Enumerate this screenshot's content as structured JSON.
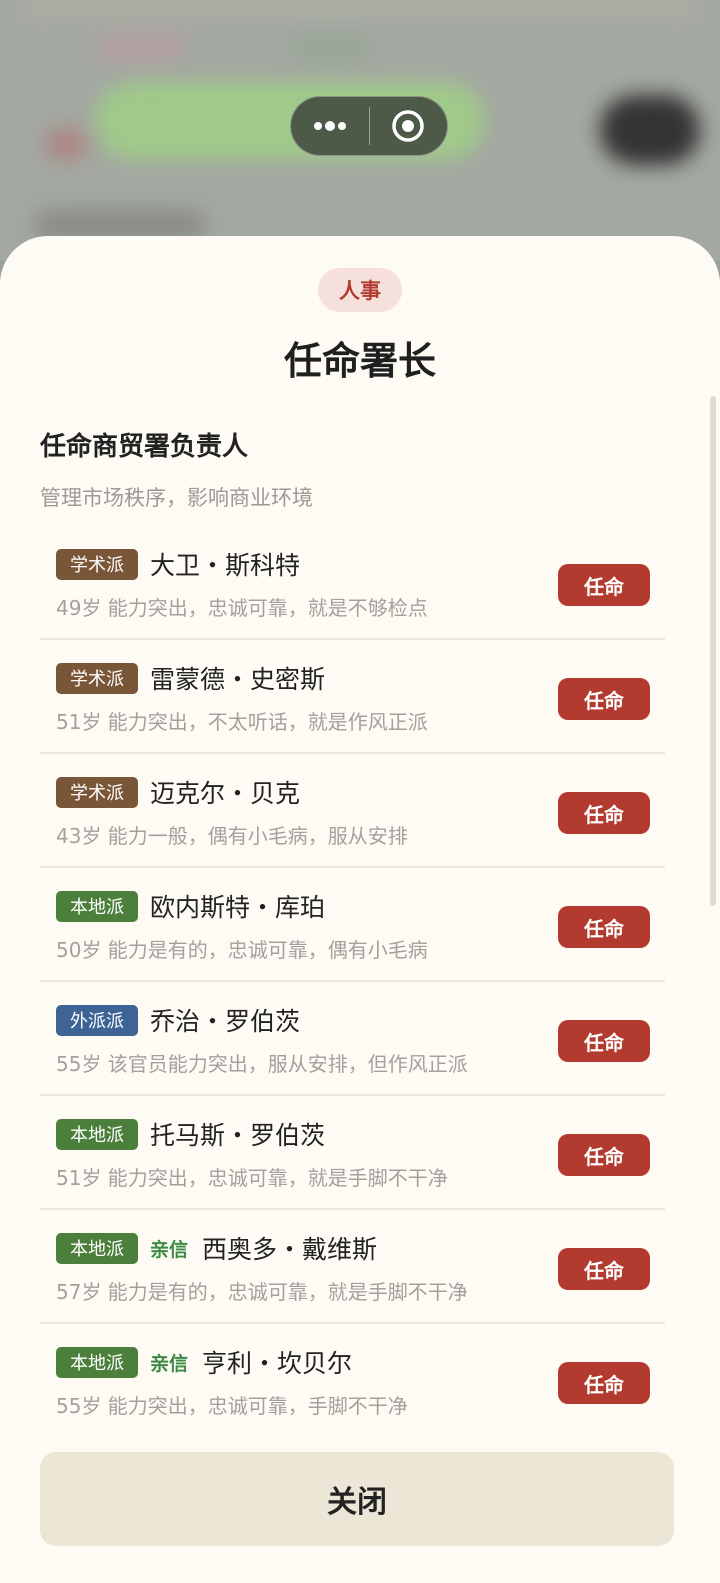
{
  "header": {
    "category_tag": "人事",
    "title": "任命署长"
  },
  "section": {
    "title": "任命商贸署负责人",
    "description": "管理市场秩序，影响商业环境"
  },
  "factions": {
    "academic": {
      "label": "学术派",
      "color": "#7a5638"
    },
    "local": {
      "label": "本地派",
      "color": "#4c7f3c"
    },
    "foreign": {
      "label": "外派派",
      "color": "#3d6494"
    }
  },
  "candidates": [
    {
      "faction": "学术派",
      "faction_color": "#7a5638",
      "trusted": "",
      "name": "大卫・斯科特",
      "description": "49岁 能力突出，忠诚可靠，就是不够检点"
    },
    {
      "faction": "学术派",
      "faction_color": "#7a5638",
      "trusted": "",
      "name": "雷蒙德・史密斯",
      "description": "51岁 能力突出，不太听话，就是作风正派"
    },
    {
      "faction": "学术派",
      "faction_color": "#7a5638",
      "trusted": "",
      "name": "迈克尔・贝克",
      "description": "43岁 能力一般，偶有小毛病，服从安排"
    },
    {
      "faction": "本地派",
      "faction_color": "#4c7f3c",
      "trusted": "",
      "name": "欧内斯特・库珀",
      "description": "50岁 能力是有的，忠诚可靠，偶有小毛病"
    },
    {
      "faction": "外派派",
      "faction_color": "#3d6494",
      "trusted": "",
      "name": "乔治・罗伯茨",
      "description": "55岁 该官员能力突出，服从安排，但作风正派"
    },
    {
      "faction": "本地派",
      "faction_color": "#4c7f3c",
      "trusted": "",
      "name": "托马斯・罗伯茨",
      "description": "51岁 能力突出，忠诚可靠，就是手脚不干净"
    },
    {
      "faction": "本地派",
      "faction_color": "#4c7f3c",
      "trusted": "亲信",
      "name": "西奥多・戴维斯",
      "description": "57岁 能力是有的，忠诚可靠，就是手脚不干净"
    },
    {
      "faction": "本地派",
      "faction_color": "#4c7f3c",
      "trusted": "亲信",
      "name": "亨利・坎贝尔",
      "description": "55岁 能力突出，忠诚可靠，手脚不干净"
    }
  ],
  "appoint_label": "任命",
  "close_label": "关闭",
  "colors": {
    "accent_red": "#b23a2e",
    "sheet_bg": "#fdfbf4",
    "close_bg": "#ebe6d6",
    "trusted_green": "#3c8a43"
  },
  "icons": {
    "more": "more-dots-icon",
    "exit": "target-circle-icon"
  }
}
